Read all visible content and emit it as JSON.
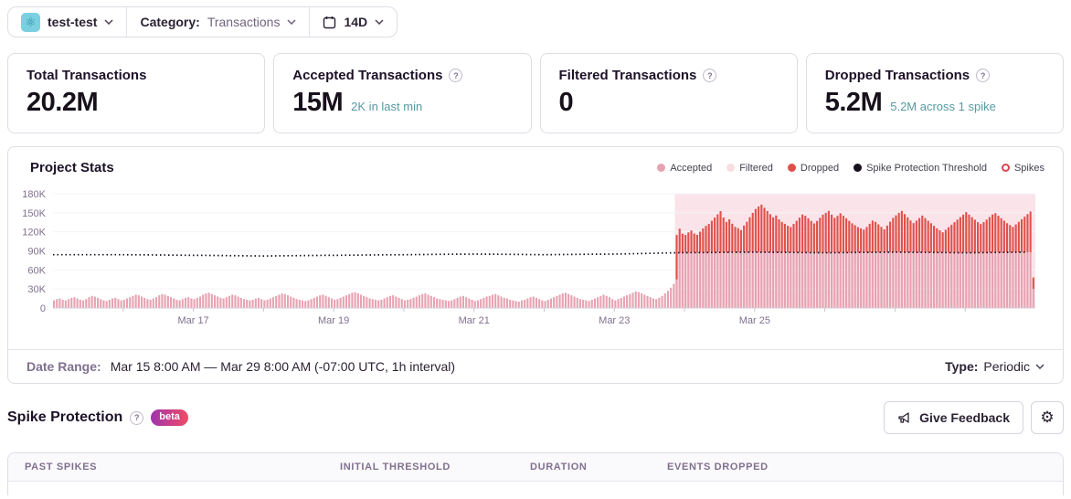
{
  "icons": {
    "help": "?",
    "gear": "⚙",
    "project": "⚛"
  },
  "topbar": {
    "project_name": "test-test",
    "category_label": "Category:",
    "category_value": "Transactions",
    "date_range_button": "14D"
  },
  "stats": [
    {
      "title": "Total Transactions",
      "value": "20.2M",
      "subtext": ""
    },
    {
      "title": "Accepted Transactions",
      "value": "15M",
      "subtext": "2K in last min"
    },
    {
      "title": "Filtered Transactions",
      "value": "0",
      "subtext": ""
    },
    {
      "title": "Dropped Transactions",
      "value": "5.2M",
      "subtext": "5.2M across 1 spike"
    }
  ],
  "chart": {
    "title": "Project Stats",
    "legend": [
      {
        "label": "Accepted"
      },
      {
        "label": "Filtered"
      },
      {
        "label": "Dropped"
      },
      {
        "label": "Spike Protection Threshold"
      },
      {
        "label": "Spikes"
      }
    ]
  },
  "chart_data": {
    "type": "bar",
    "title": "Project Stats",
    "x_start": "Mar 15 8:00 AM",
    "x_end": "Mar 29 8:00 AM",
    "interval": "1h",
    "num_bars": 336,
    "unit": "K (thousands of transactions per hour)",
    "ylim": [
      0,
      180
    ],
    "y_tick_labels": [
      "0",
      "30K",
      "60K",
      "90K",
      "120K",
      "150K",
      "180K"
    ],
    "x_ticks": [
      {
        "label": "Mar 17",
        "hour": 48
      },
      {
        "label": "Mar 19",
        "hour": 96
      },
      {
        "label": "Mar 21",
        "hour": 144
      },
      {
        "label": "Mar 23",
        "hour": 192
      },
      {
        "label": "Mar 25",
        "hour": 240
      }
    ],
    "series_accepted_pre_spike": [
      12,
      14,
      15,
      13,
      12,
      14,
      16,
      17,
      15,
      13,
      12,
      14,
      17,
      19,
      18,
      16,
      14,
      12,
      11,
      13,
      15,
      16,
      14,
      12,
      13,
      15,
      17,
      19,
      21,
      20,
      18,
      16,
      14,
      13,
      15,
      17,
      20,
      22,
      21,
      19,
      17,
      15,
      13,
      12,
      14,
      16,
      17,
      15,
      14,
      16,
      18,
      21,
      23,
      24,
      22,
      20,
      18,
      16,
      15,
      17,
      19,
      21,
      20,
      18,
      16,
      14,
      13,
      12,
      13,
      15,
      16,
      14,
      12,
      13,
      15,
      17,
      19,
      21,
      23,
      22,
      20,
      18,
      16,
      14,
      13,
      12,
      11,
      12,
      14,
      16,
      18,
      20,
      21,
      19,
      17,
      15,
      13,
      14,
      16,
      18,
      20,
      22,
      24,
      25,
      23,
      21,
      19,
      17,
      15,
      14,
      13,
      12,
      13,
      15,
      17,
      19,
      20,
      18,
      16,
      14,
      12,
      13,
      14,
      16,
      18,
      20,
      22,
      23,
      21,
      19,
      17,
      15,
      14,
      13,
      12,
      11,
      12,
      14,
      16,
      18,
      19,
      17,
      15,
      13,
      11,
      12,
      14,
      16,
      18,
      19,
      21,
      22,
      20,
      18,
      16,
      15,
      13,
      12,
      11,
      10,
      12,
      13,
      15,
      17,
      18,
      16,
      14,
      12,
      11,
      13,
      15,
      17,
      19,
      21,
      23,
      24,
      22,
      20,
      18,
      16,
      14,
      13,
      12,
      11,
      13,
      15,
      17,
      19,
      21,
      19,
      17,
      14,
      12,
      14,
      16,
      18,
      20,
      22,
      24,
      26,
      25,
      23,
      21,
      19,
      17,
      15,
      14,
      16,
      19,
      23,
      27,
      32,
      38
    ],
    "spike": {
      "start_hour": 213,
      "region_label": "1 spike",
      "accepted_during_spike": "capped_at_threshold",
      "first_bar_accepted": 45,
      "last_bar_accepted": 30,
      "dropped": [
        70,
        38,
        30,
        28,
        32,
        35,
        30,
        28,
        33,
        38,
        42,
        45,
        50,
        55,
        60,
        65,
        55,
        48,
        52,
        45,
        40,
        38,
        35,
        42,
        48,
        55,
        62,
        68,
        72,
        75,
        70,
        65,
        60,
        55,
        58,
        52,
        48,
        45,
        42,
        40,
        45,
        50,
        55,
        60,
        58,
        54,
        50,
        46,
        50,
        55,
        60,
        63,
        66,
        60,
        55,
        58,
        62,
        58,
        54,
        50,
        46,
        43,
        40,
        38,
        36,
        40,
        45,
        50,
        48,
        44,
        40,
        36,
        42,
        48,
        54,
        58,
        62,
        65,
        60,
        55,
        50,
        46,
        50,
        54,
        58,
        54,
        50,
        46,
        42,
        38,
        35,
        32,
        36,
        40,
        44,
        48,
        52,
        56,
        60,
        64,
        60,
        56,
        52,
        48,
        45,
        48,
        52,
        56,
        60,
        62,
        58,
        54,
        50,
        46,
        43,
        40,
        44,
        48,
        52,
        56,
        60,
        64,
        18
      ]
    },
    "threshold_points": [
      [
        0,
        84
      ],
      [
        24,
        84
      ],
      [
        48,
        83
      ],
      [
        72,
        82
      ],
      [
        96,
        83
      ],
      [
        120,
        84
      ],
      [
        144,
        85
      ],
      [
        168,
        84
      ],
      [
        192,
        85
      ],
      [
        213,
        87
      ],
      [
        240,
        88
      ],
      [
        264,
        87
      ],
      [
        288,
        88
      ],
      [
        312,
        87
      ],
      [
        335,
        88
      ]
    ],
    "filtered_total": 0,
    "legend_position": "top-right",
    "grid": "faint",
    "colors": {
      "accepted": "#e7a2b1",
      "filtered": "#f7dee3",
      "dropped": "#e0504a",
      "threshold": "#17101f",
      "spike_region": "rgba(230,120,150,0.20)",
      "spike_ring": "#dd4450",
      "axis_text": "#80708f"
    }
  },
  "footer": {
    "date_range_label": "Date Range:",
    "date_range_value": "Mar 15 8:00 AM — Mar 29 8:00 AM (-07:00 UTC, 1h interval)",
    "type_label": "Type:",
    "type_value": "Periodic"
  },
  "spike_section": {
    "title": "Spike Protection",
    "beta_badge": "beta",
    "feedback_button": "Give Feedback"
  },
  "table": {
    "headers": [
      "PAST SPIKES",
      "INITIAL THRESHOLD",
      "DURATION",
      "EVENTS DROPPED"
    ]
  }
}
